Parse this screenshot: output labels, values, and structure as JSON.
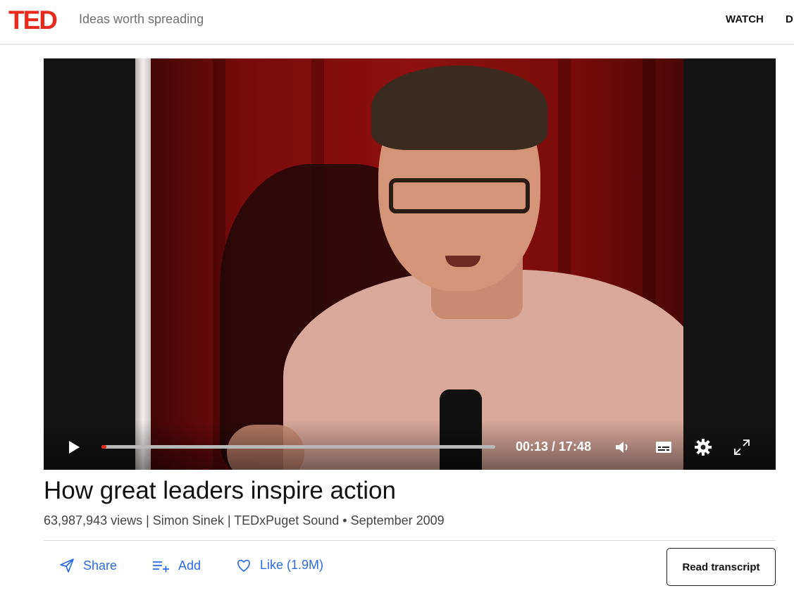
{
  "header": {
    "logo": "TED",
    "tagline": "Ideas worth spreading",
    "nav": [
      "WATCH",
      "D"
    ]
  },
  "player": {
    "current_time": "00:13",
    "duration": "17:48",
    "time_display": "00:13 / 17:48",
    "progress_fraction": 0.012
  },
  "talk": {
    "title": "How great leaders inspire action",
    "meta": "63,987,943 views | Simon Sinek | TEDxPuget Sound • September 2009"
  },
  "actions": {
    "share_label": "Share",
    "add_label": "Add",
    "like_label": "Like (1.9M)",
    "transcript_label": "Read transcript"
  },
  "colors": {
    "brand": "#e62b1e",
    "link": "#2b6be4"
  }
}
